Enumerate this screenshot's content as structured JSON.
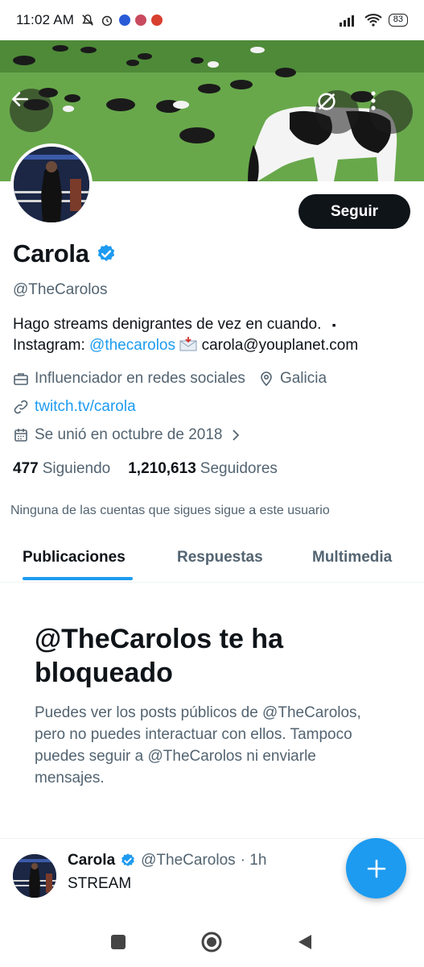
{
  "status_bar": {
    "time": "11:02 AM",
    "battery": "83",
    "icons": [
      "mute-icon",
      "alarm-icon",
      "app-icon",
      "app-icon",
      "app-icon",
      "signal-icon",
      "wifi-icon",
      "battery-icon"
    ]
  },
  "profile": {
    "name": "Carola",
    "handle": "@TheCarolos",
    "follow_label": "Seguir",
    "bio_line1": "Hago streams denigrantes de vez en cuando.",
    "bio_line1_suffix": "▪",
    "bio_instagram_label": "Instagram:",
    "bio_instagram_link": "@thecarolos",
    "bio_email": "carola@youplanet.com",
    "category": "Influenciador en redes sociales",
    "location": "Galicia",
    "website": "twitch.tv/carola",
    "joined": "Se unió en octubre de 2018",
    "following_count": "477",
    "following_label": "Siguiendo",
    "followers_count": "1,210,613",
    "followers_label": "Seguidores",
    "mutuals_text": "Ninguna de las cuentas que sigues sigue a este usuario"
  },
  "tabs": [
    {
      "label": "Publicaciones",
      "active": true
    },
    {
      "label": "Respuestas",
      "active": false
    },
    {
      "label": "Multimedia",
      "active": false
    }
  ],
  "blocked": {
    "title": "@TheCarolos te ha bloqueado",
    "description": "Puedes ver los posts públicos de @TheCarolos, pero no puedes interactuar con ellos. Tampoco puedes seguir a @TheCarolos ni enviarle mensajes."
  },
  "post": {
    "name": "Carola",
    "handle": "@TheCarolos",
    "time": "· 1h",
    "text": "STREAM"
  },
  "colors": {
    "accent": "#1d9bf0",
    "text": "#0f1419",
    "secondary": "#536471"
  }
}
